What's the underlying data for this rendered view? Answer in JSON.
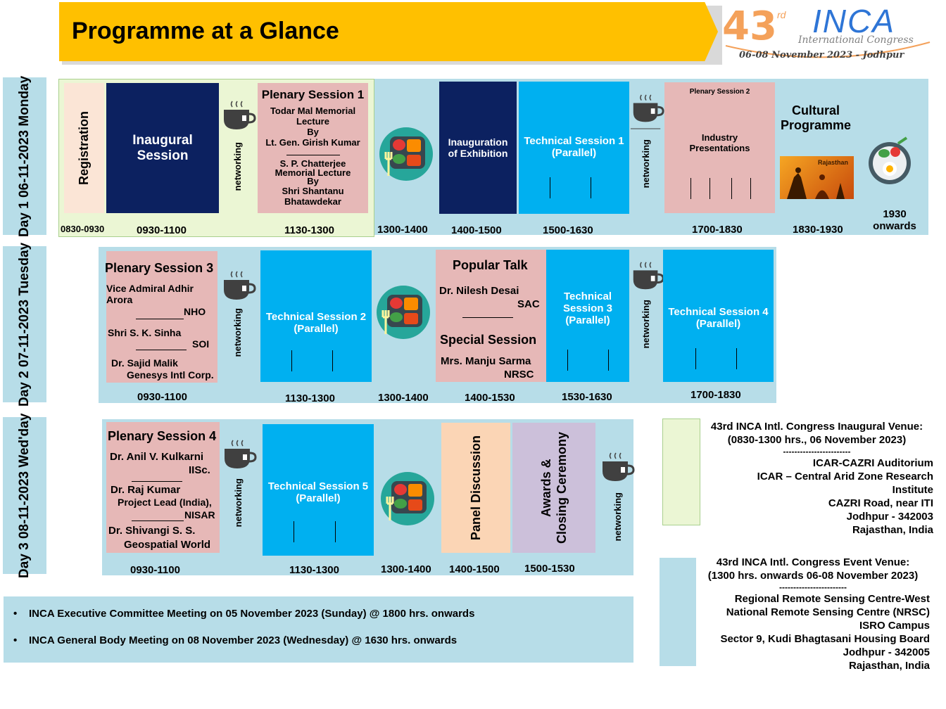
{
  "header": {
    "title": "Programme at a Glance"
  },
  "logo": {
    "number": "43",
    "suffix": "rd",
    "name": "INCA",
    "subtitle": "International Congress",
    "dates": "06-08 November 2023 - Jodhpur"
  },
  "colors": {
    "orange": "#ffc000",
    "navy": "#0c2160",
    "blue": "#00b0f0",
    "pink": "#e6b8b7",
    "lightblue": "#b7dde8",
    "green": "#ebf6d4",
    "peach": "#fbd5b5",
    "lavender": "#ccc0da"
  },
  "day1": {
    "label": "Day  1  06-11-2023 Monday",
    "registration": "Registration",
    "inaugural": "Inaugural Session",
    "networking": "networking",
    "plenary": {
      "title": "Plenary Session 1",
      "l1": "Todar Mal  Memorial",
      "l2": "Lecture",
      "l3": "By",
      "l4": "Lt. Gen. Girish Kumar",
      "l5": "S. P. Chatterjee",
      "l6": "Memorial Lecture",
      "l7": "By",
      "l8": "Shri Shantanu",
      "l9": "Bhatawdekar"
    },
    "exhibition": {
      "l1": "Inauguration",
      "l2": "of Exhibition"
    },
    "tech": {
      "l1": "Technical Session 1",
      "l2": "(Parallel)"
    },
    "plenary2": {
      "title": "Plenary Session 2",
      "l1": "Industry",
      "l2": "Presentations"
    },
    "cultural": {
      "l1": "Cultural",
      "l2": "Programme"
    },
    "rajasthan_caption": "Rajasthan",
    "times": {
      "t1": "0830-0930",
      "t2": "0930-1100",
      "t3": "1130-1300",
      "t4": "1300-1400",
      "t5": "1400-1500",
      "t6": "1500-1630",
      "t7": "1700-1830",
      "t8": "1830-1930",
      "t9a": "1930",
      "t9b": "onwards"
    }
  },
  "day2": {
    "label": "Day  2  07-11-2023 Tuesday",
    "plenary": {
      "title": "Plenary Session 3",
      "p1a": "Vice Admiral  Adhir",
      "p1b": "Arora",
      "p1c": "NHO",
      "p2a": "Shri S. K. Sinha",
      "p2c": "SOI",
      "p3a": "Dr. Sajid Malik",
      "p3b": "Genesys Intl Corp."
    },
    "networking": "networking",
    "tech2": {
      "l1": "Technical Session 2",
      "l2": "(Parallel)"
    },
    "popular": {
      "title": "Popular Talk",
      "name": "Dr. Nilesh Desai",
      "org": "SAC",
      "special": "Special Session",
      "sname": "Mrs. Manju  Sarma",
      "sorg": "NRSC"
    },
    "tech3": {
      "l1": "Technical",
      "l2": "Session 3",
      "l3": "(Parallel)"
    },
    "tech4": {
      "l1": "Technical Session 4",
      "l2": "(Parallel)"
    },
    "times": {
      "t1": "0930-1100",
      "t2": "1130-1300",
      "t3": "1300-1400",
      "t4": "1400-1530",
      "t5": "1530-1630",
      "t6": "1700-1830"
    }
  },
  "day3": {
    "label": "Day  3  08-11-2023 Wed'day",
    "plenary": {
      "title": "Plenary Session 4",
      "p1a": "Dr. Anil V. Kulkarni",
      "p1b": "IISc.",
      "p2a": "Dr. Raj Kumar",
      "p2b": "Project Lead (India),",
      "p2c": "NISAR",
      "p3a": "Dr. Shivangi S. S.",
      "p3b": "Geospatial World"
    },
    "networking": "networking",
    "tech5": {
      "l1": "Technical Session 5",
      "l2": "(Parallel)"
    },
    "panel": "Panel Discussion",
    "awards": {
      "l1": "Awards &",
      "l2": "Closing Ceremony"
    },
    "times": {
      "t1": "0930-1100",
      "t2": "1130-1300",
      "t3": "1300-1400",
      "t4": "1400-1500",
      "t5": "1500-1530"
    }
  },
  "notes": [
    "INCA Executive Committee Meeting on 05 November 2023 (Sunday) @ 1800 hrs. onwards",
    "INCA General Body Meeting on 08 November 2023 (Wednesday) @ 1630 hrs. onwards"
  ],
  "venue1": {
    "title": "43rd INCA Intl. Congress Inaugural Venue:",
    "sub": "(0830-1300 hrs., 06 November 2023)",
    "sep": "------------------------",
    "l1": "ICAR-CAZRI Auditorium",
    "l2": "ICAR – Central Arid Zone Research",
    "l3": "Institute",
    "l4": "CAZRI Road, near ITI",
    "l5": "Jodhpur - 342003",
    "l6": "Rajasthan, India"
  },
  "venue2": {
    "title": "43rd INCA Intl. Congress Event Venue:",
    "sub": "(1300 hrs. onwards 06-08 November 2023)",
    "sep": "------------------------",
    "l1": "Regional Remote Sensing Centre-West",
    "l2": "National Remote Sensing Centre (NRSC)",
    "l3": "ISRO Campus",
    "l4": "Sector 9, Kudi Bhagtasani Housing Board",
    "l5": "Jodhpur - 342005",
    "l6": "Rajasthan, India"
  }
}
